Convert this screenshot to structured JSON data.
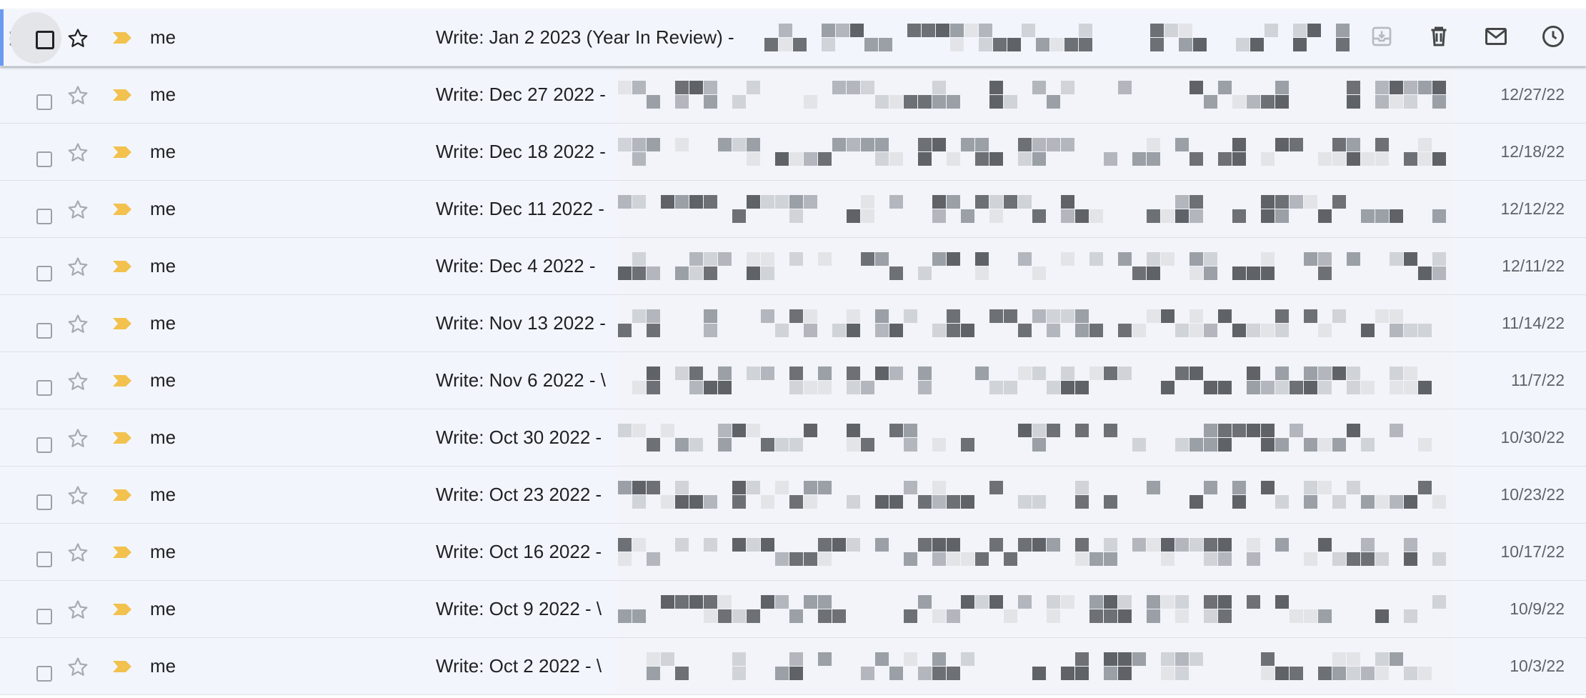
{
  "emails": [
    {
      "sender": "me",
      "subject": "Write: Jan 2 2023 (Year In Review) -",
      "date": "",
      "hover": true
    },
    {
      "sender": "me",
      "subject": "Write: Dec 27 2022 -",
      "date": "12/27/22"
    },
    {
      "sender": "me",
      "subject": "Write: Dec 18 2022 -",
      "date": "12/18/22"
    },
    {
      "sender": "me",
      "subject": "Write: Dec 11 2022 -",
      "date": "12/12/22"
    },
    {
      "sender": "me",
      "subject": "Write: Dec 4 2022 -",
      "date": "12/11/22"
    },
    {
      "sender": "me",
      "subject": "Write: Nov 13 2022 -",
      "date": "11/14/22"
    },
    {
      "sender": "me",
      "subject": "Write: Nov 6 2022 - \\",
      "date": "11/7/22"
    },
    {
      "sender": "me",
      "subject": "Write: Oct 30 2022 -",
      "date": "10/30/22"
    },
    {
      "sender": "me",
      "subject": "Write: Oct 23 2022 -",
      "date": "10/23/22"
    },
    {
      "sender": "me",
      "subject": "Write: Oct 16 2022 -",
      "date": "10/17/22"
    },
    {
      "sender": "me",
      "subject": "Write: Oct 9 2022 - \\",
      "date": "10/9/22"
    },
    {
      "sender": "me",
      "subject": "Write: Oct 2 2022 - \\",
      "date": "10/3/22"
    }
  ],
  "hover_actions": [
    "archive-icon",
    "delete-icon",
    "mark-unread-icon",
    "snooze-icon"
  ],
  "colors": {
    "important": "#f2c14e",
    "row_bg": "#f2f6fc",
    "accent": "#6b9bf0"
  }
}
